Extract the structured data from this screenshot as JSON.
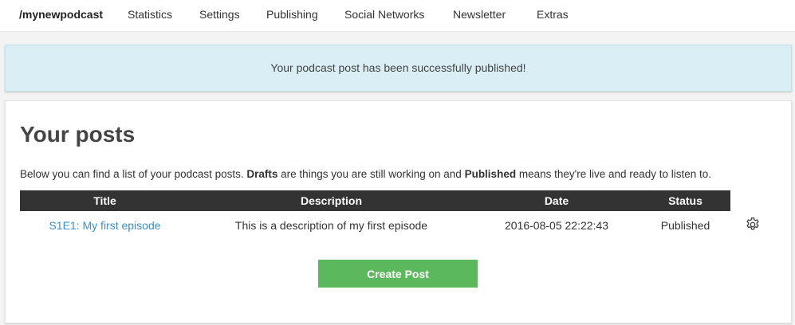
{
  "nav": {
    "brand": "/mynewpodcast",
    "items": [
      {
        "label": "Statistics"
      },
      {
        "label": "Settings"
      },
      {
        "label": "Publishing"
      },
      {
        "label": "Social Networks"
      },
      {
        "label": "Newsletter"
      },
      {
        "label": "Extras"
      }
    ]
  },
  "alert": {
    "message": "Your podcast post has been successfully published!"
  },
  "posts": {
    "title": "Your posts",
    "intro": {
      "part1": "Below you can find a list of your podcast posts. ",
      "drafts": "Drafts",
      "part2": " are things you are still working on and ",
      "published": "Published",
      "part3": " means they're live and ready to listen to."
    },
    "columns": [
      "Title",
      "Description",
      "Date",
      "Status"
    ],
    "rows": [
      {
        "title": "S1E1: My first episode",
        "description": "This is a description of my first episode",
        "date": "2016-08-05 22:22:43",
        "status": "Published",
        "settings_icon": "gear-icon"
      }
    ],
    "create_button": "Create Post"
  },
  "colors": {
    "alert_bg": "#d9eef5",
    "table_header_bg": "#333333",
    "link": "#3a8fc8",
    "button": "#5cb85c"
  }
}
